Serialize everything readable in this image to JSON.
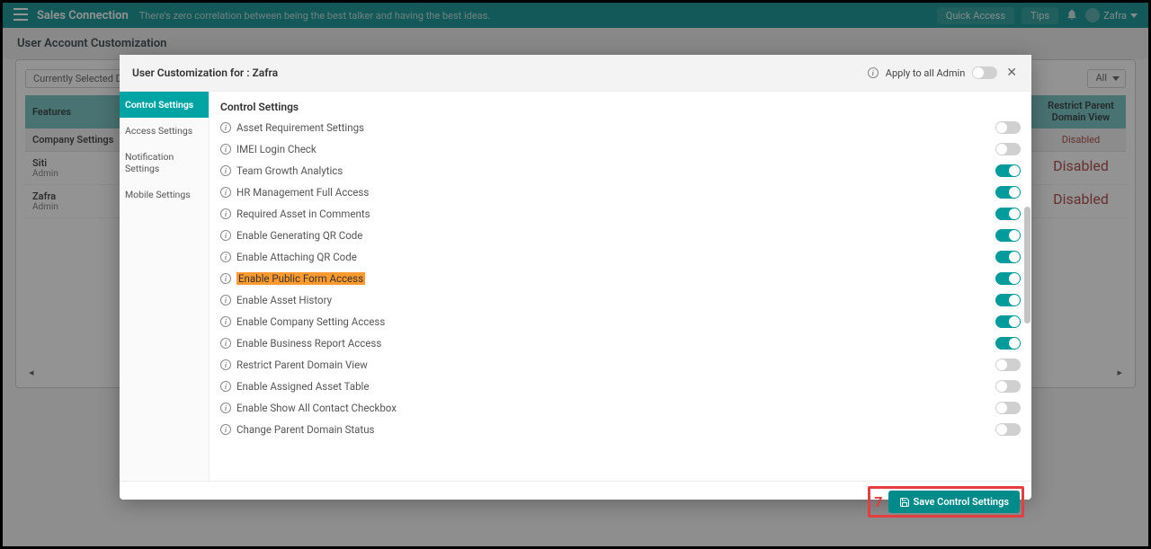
{
  "topbar": {
    "brand": "Sales Connection",
    "tagline": "There's zero correlation between being the best talker and having the best ideas.",
    "quick_access": "Quick Access",
    "tips": "Tips",
    "username": "Zafra"
  },
  "page": {
    "title": "User Account Customization",
    "selected_dept": "Currently Selected De",
    "filter_all": "All",
    "th_features": "Features",
    "th_restrict": "Restrict Parent Domain View",
    "th_company": "Company Settings",
    "disabled": "Disabled",
    "users": [
      {
        "name": "Siti",
        "role": "Admin"
      },
      {
        "name": "Zafra",
        "role": "Admin"
      }
    ]
  },
  "modal": {
    "title": "User Customization for : Zafra",
    "apply_all": "Apply to all Admin",
    "sidebar": [
      {
        "label": "Control Settings",
        "active": true
      },
      {
        "label": "Access Settings",
        "active": false
      },
      {
        "label": "Notification Settings",
        "active": false
      },
      {
        "label": "Mobile Settings",
        "active": false
      }
    ],
    "settings_title": "Control Settings",
    "settings": [
      {
        "label": "Asset Requirement Settings",
        "on": false,
        "highlight": false
      },
      {
        "label": "IMEI Login Check",
        "on": false,
        "highlight": false
      },
      {
        "label": "Team Growth Analytics",
        "on": true,
        "highlight": false
      },
      {
        "label": "HR Management Full Access",
        "on": true,
        "highlight": false
      },
      {
        "label": "Required Asset in Comments",
        "on": true,
        "highlight": false
      },
      {
        "label": "Enable Generating QR Code",
        "on": true,
        "highlight": false
      },
      {
        "label": "Enable Attaching QR Code",
        "on": true,
        "highlight": false
      },
      {
        "label": "Enable Public Form Access",
        "on": true,
        "highlight": true
      },
      {
        "label": "Enable Asset History",
        "on": true,
        "highlight": false
      },
      {
        "label": "Enable Company Setting Access",
        "on": true,
        "highlight": false
      },
      {
        "label": "Enable Business Report Access",
        "on": true,
        "highlight": false
      },
      {
        "label": "Restrict Parent Domain View",
        "on": false,
        "highlight": false
      },
      {
        "label": "Enable Assigned Asset Table",
        "on": false,
        "highlight": false
      },
      {
        "label": "Enable Show All Contact Checkbox",
        "on": false,
        "highlight": false
      },
      {
        "label": "Change Parent Domain Status",
        "on": false,
        "highlight": false
      }
    ],
    "save_label": "Save Control Settings",
    "callout_num": "7"
  }
}
